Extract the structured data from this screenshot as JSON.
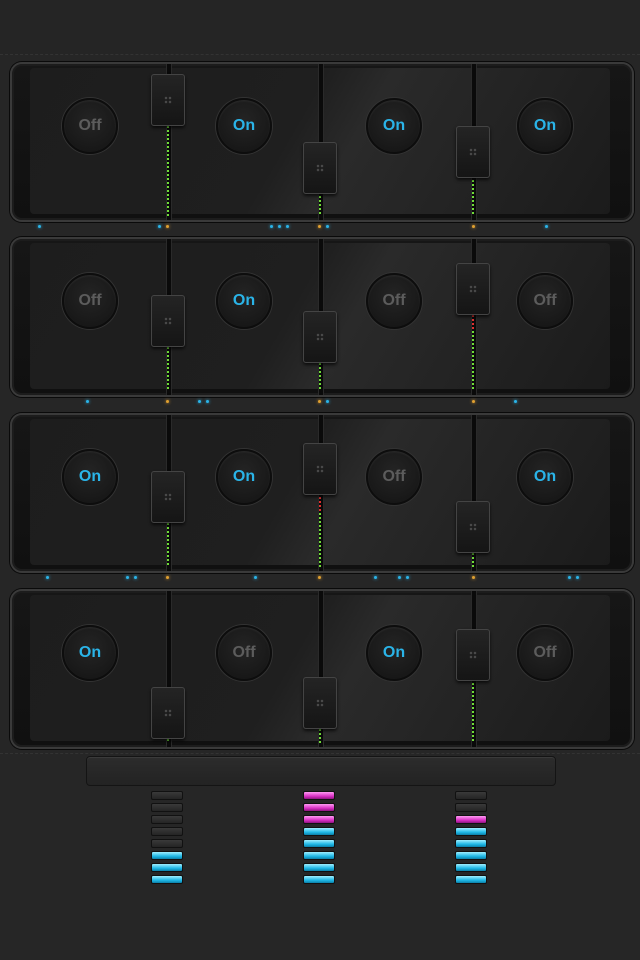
{
  "colors": {
    "on_text": "#2ab4e8",
    "off_text": "#5c5c5c",
    "meter_green": "#6fdc38",
    "meter_red": "#e03030",
    "led_blue": "#2ab4e8",
    "led_orange": "#e0a030",
    "level_cyan": "#1fb8e6",
    "level_magenta": "#d92fc4"
  },
  "rows": [
    {
      "buttons": [
        "Off",
        "On",
        "On",
        "On"
      ]
    },
    {
      "buttons": [
        "Off",
        "On",
        "Off",
        "Off"
      ]
    },
    {
      "buttons": [
        "On",
        "On",
        "Off",
        "On"
      ]
    },
    {
      "buttons": [
        "On",
        "Off",
        "On",
        "Off"
      ]
    }
  ],
  "level_meters": [
    {
      "lit": 3,
      "color": "cyan",
      "total": 8
    },
    {
      "lit": 8,
      "color": "cyan-magenta",
      "magenta": 3,
      "total": 8
    },
    {
      "lit": 6,
      "color": "cyan-magenta",
      "magenta": 1,
      "total": 8
    }
  ]
}
